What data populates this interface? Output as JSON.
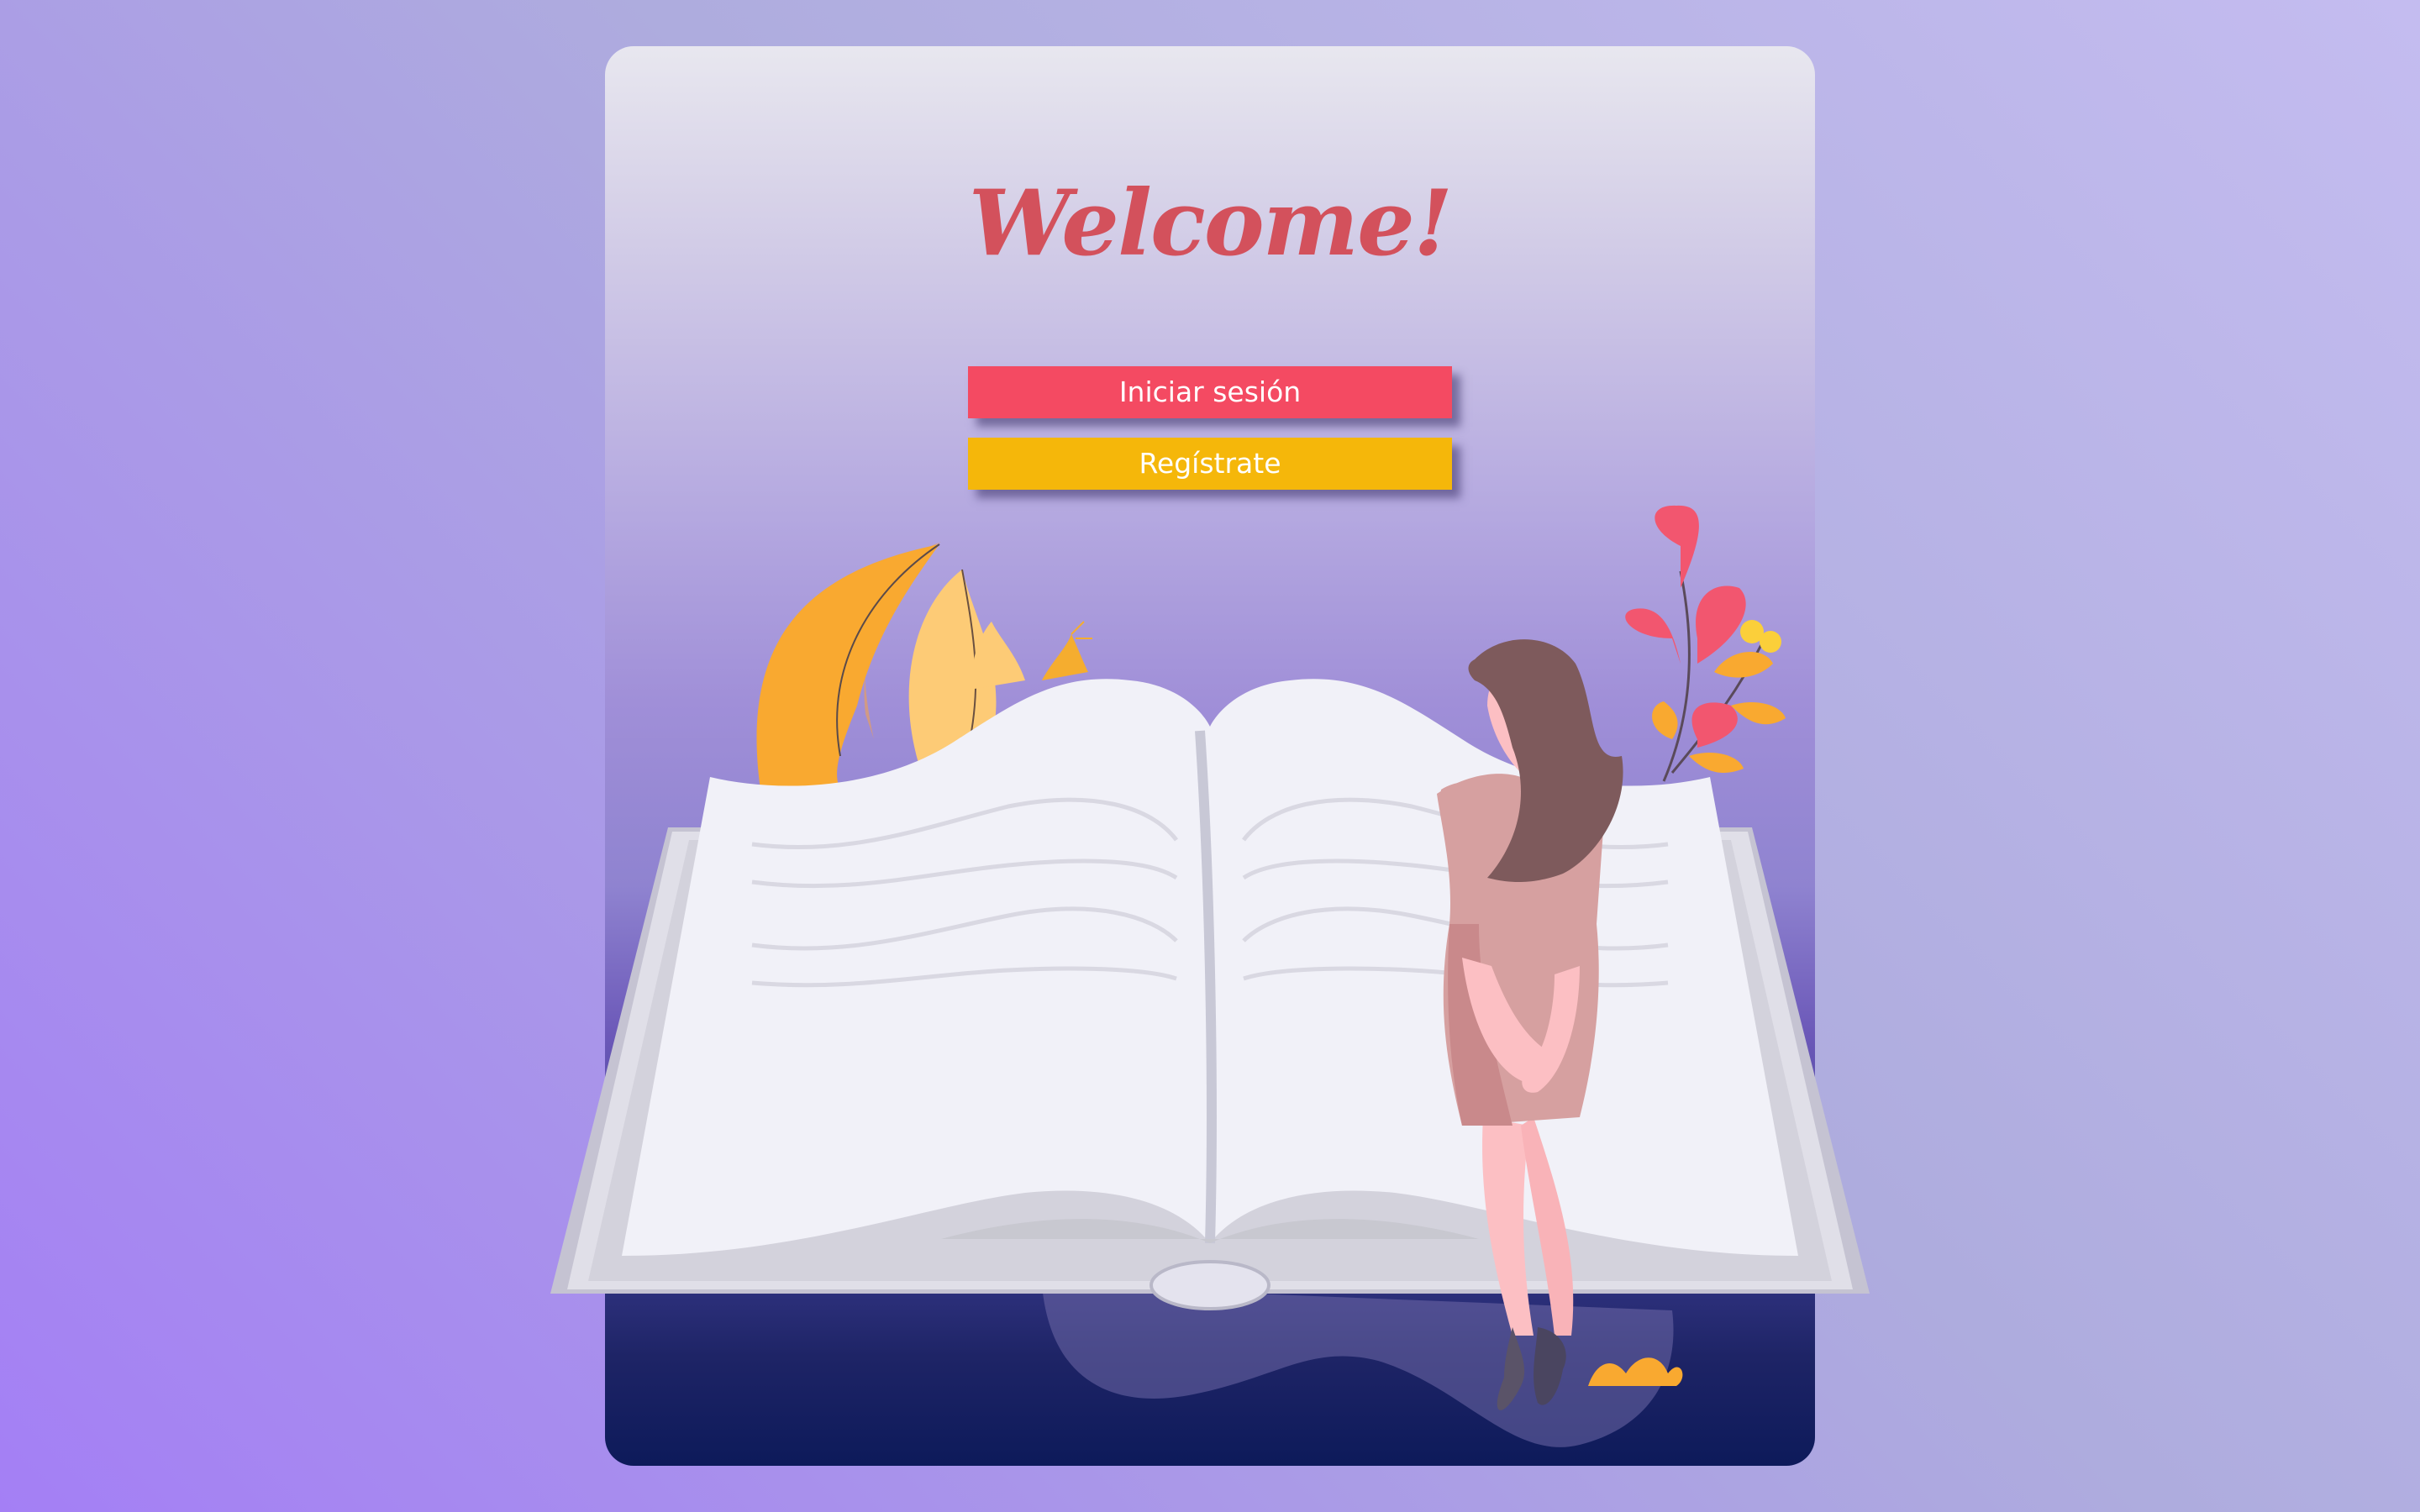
{
  "welcome": {
    "title": "Welcome!",
    "login_label": "Iniciar sesión",
    "register_label": "Regístrate"
  },
  "colors": {
    "title": "#d3515c",
    "login_button": "#f44a62",
    "register_button": "#f5b70a",
    "page_bg": "#a79ae6",
    "card_bottom": "#0d1a5a"
  },
  "illustration": {
    "subject": "woman-reading-open-book-icon"
  }
}
